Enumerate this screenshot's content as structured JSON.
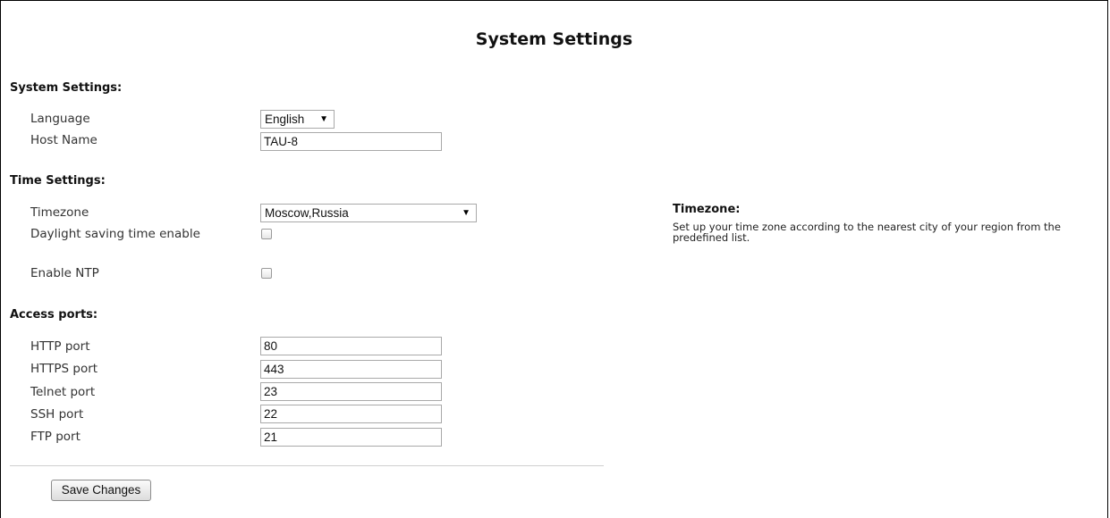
{
  "page": {
    "title": "System Settings"
  },
  "system_settings": {
    "heading": "System Settings:",
    "language_label": "Language",
    "language_value": "English",
    "hostname_label": "Host Name",
    "hostname_value": "TAU-8"
  },
  "time_settings": {
    "heading": "Time Settings:",
    "timezone_label": "Timezone",
    "timezone_value": "Moscow,Russia",
    "dst_label": "Daylight saving time enable",
    "dst_checked": false,
    "ntp_label": "Enable NTP",
    "ntp_checked": false
  },
  "access_ports": {
    "heading": "Access ports:",
    "http_label": "HTTP port",
    "http_value": "80",
    "https_label": "HTTPS port",
    "https_value": "443",
    "telnet_label": "Telnet port",
    "telnet_value": "23",
    "ssh_label": "SSH port",
    "ssh_value": "22",
    "ftp_label": "FTP port",
    "ftp_value": "21"
  },
  "help": {
    "title": "Timezone:",
    "text": "Set up your time zone according to the nearest city of your region from the predefined list."
  },
  "actions": {
    "save_label": "Save Changes"
  },
  "icons": {
    "dropdown": "triangle-down-icon"
  }
}
